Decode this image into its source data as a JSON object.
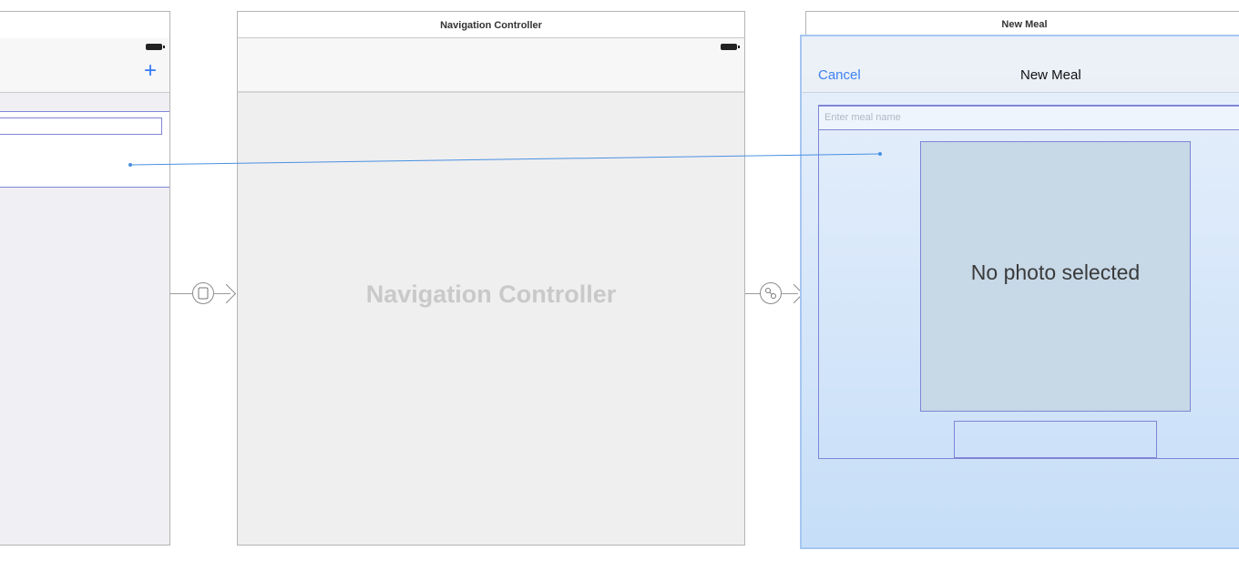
{
  "left_scene": {
    "add_button_label": "+"
  },
  "nav_scene": {
    "title": "Navigation Controller",
    "placeholder_title": "Navigation Controller"
  },
  "meal_scene": {
    "title": "New Meal",
    "nav_title": "New Meal",
    "cancel_label": "Cancel",
    "name_placeholder": "Enter meal name",
    "photo_label": "No photo selected"
  },
  "segues": [
    {
      "name": "root-view-controller-segue",
      "icon": "device-icon"
    },
    {
      "name": "modal-segue",
      "icon": "link-icon"
    }
  ],
  "colors": {
    "accent": "#3478f6",
    "selection": "#7f86d6",
    "connection": "#4a90e2"
  }
}
